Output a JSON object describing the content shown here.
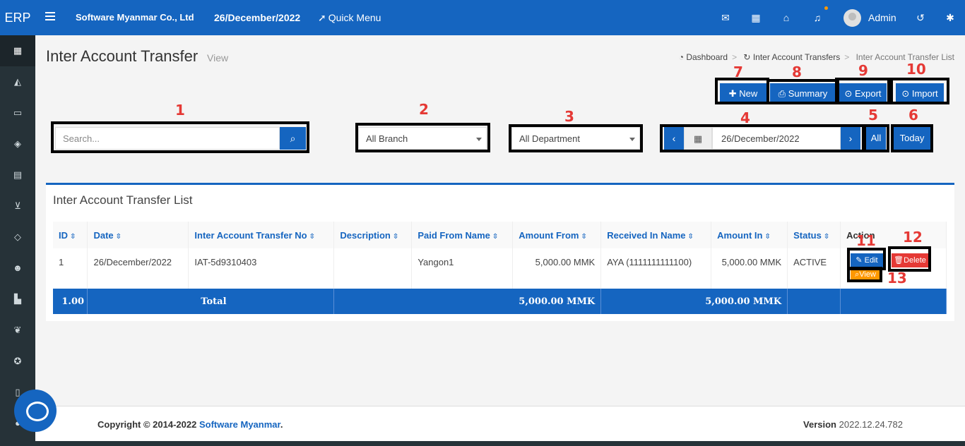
{
  "header": {
    "brand": "ERP",
    "company": "Software Myanmar Co., Ltd",
    "date": "26/December/2022",
    "quick_menu": "Quick Menu",
    "user": "Admin"
  },
  "page": {
    "title": "Inter Account Transfer",
    "subtitle": "View",
    "breadcrumb": [
      "Dashboard",
      "Inter Account Transfers",
      "Inter Account Transfer List"
    ]
  },
  "toolbar": {
    "new": "New",
    "summary": "Summary",
    "export": "Export",
    "import": "Import"
  },
  "filters": {
    "search_placeholder": "Search...",
    "branch": "All Branch",
    "department": "All Department",
    "date": "26/December/2022",
    "all": "All",
    "today": "Today"
  },
  "annotations": [
    "1",
    "2",
    "3",
    "4",
    "5",
    "6",
    "7",
    "8",
    "9",
    "10",
    "11",
    "12",
    "13"
  ],
  "list": {
    "title": "Inter Account Transfer List",
    "columns": [
      "ID",
      "Date",
      "Inter Account Transfer No",
      "Description",
      "Paid From Name",
      "Amount From",
      "Received In Name",
      "Amount In",
      "Status",
      "Action"
    ],
    "rows": [
      {
        "id": "1",
        "date": "26/December/2022",
        "no": "IAT-5d9310403",
        "description": "",
        "paid_from": "Yangon1",
        "amount_from": "5,000.00 MMK",
        "received_in": "AYA (1111111111100)",
        "amount_in": "5,000.00 MMK",
        "status": "ACTIVE"
      }
    ],
    "actions": {
      "edit": "Edit",
      "delete": "Delete",
      "view": "View"
    },
    "total": {
      "count": "1.00",
      "label": "Total",
      "amount_from": "5,000.00 MMK",
      "amount_in": "5,000.00 MMK"
    }
  },
  "footer": {
    "copyright": "Copyright © 2014-2022",
    "company_link": "Software Myanmar",
    "version_label": "Version",
    "version": "2022.12.24.782"
  },
  "colors": {
    "primary": "#1565c0",
    "danger": "#e53935",
    "warning": "#ff9800",
    "sidebar": "#263238"
  }
}
